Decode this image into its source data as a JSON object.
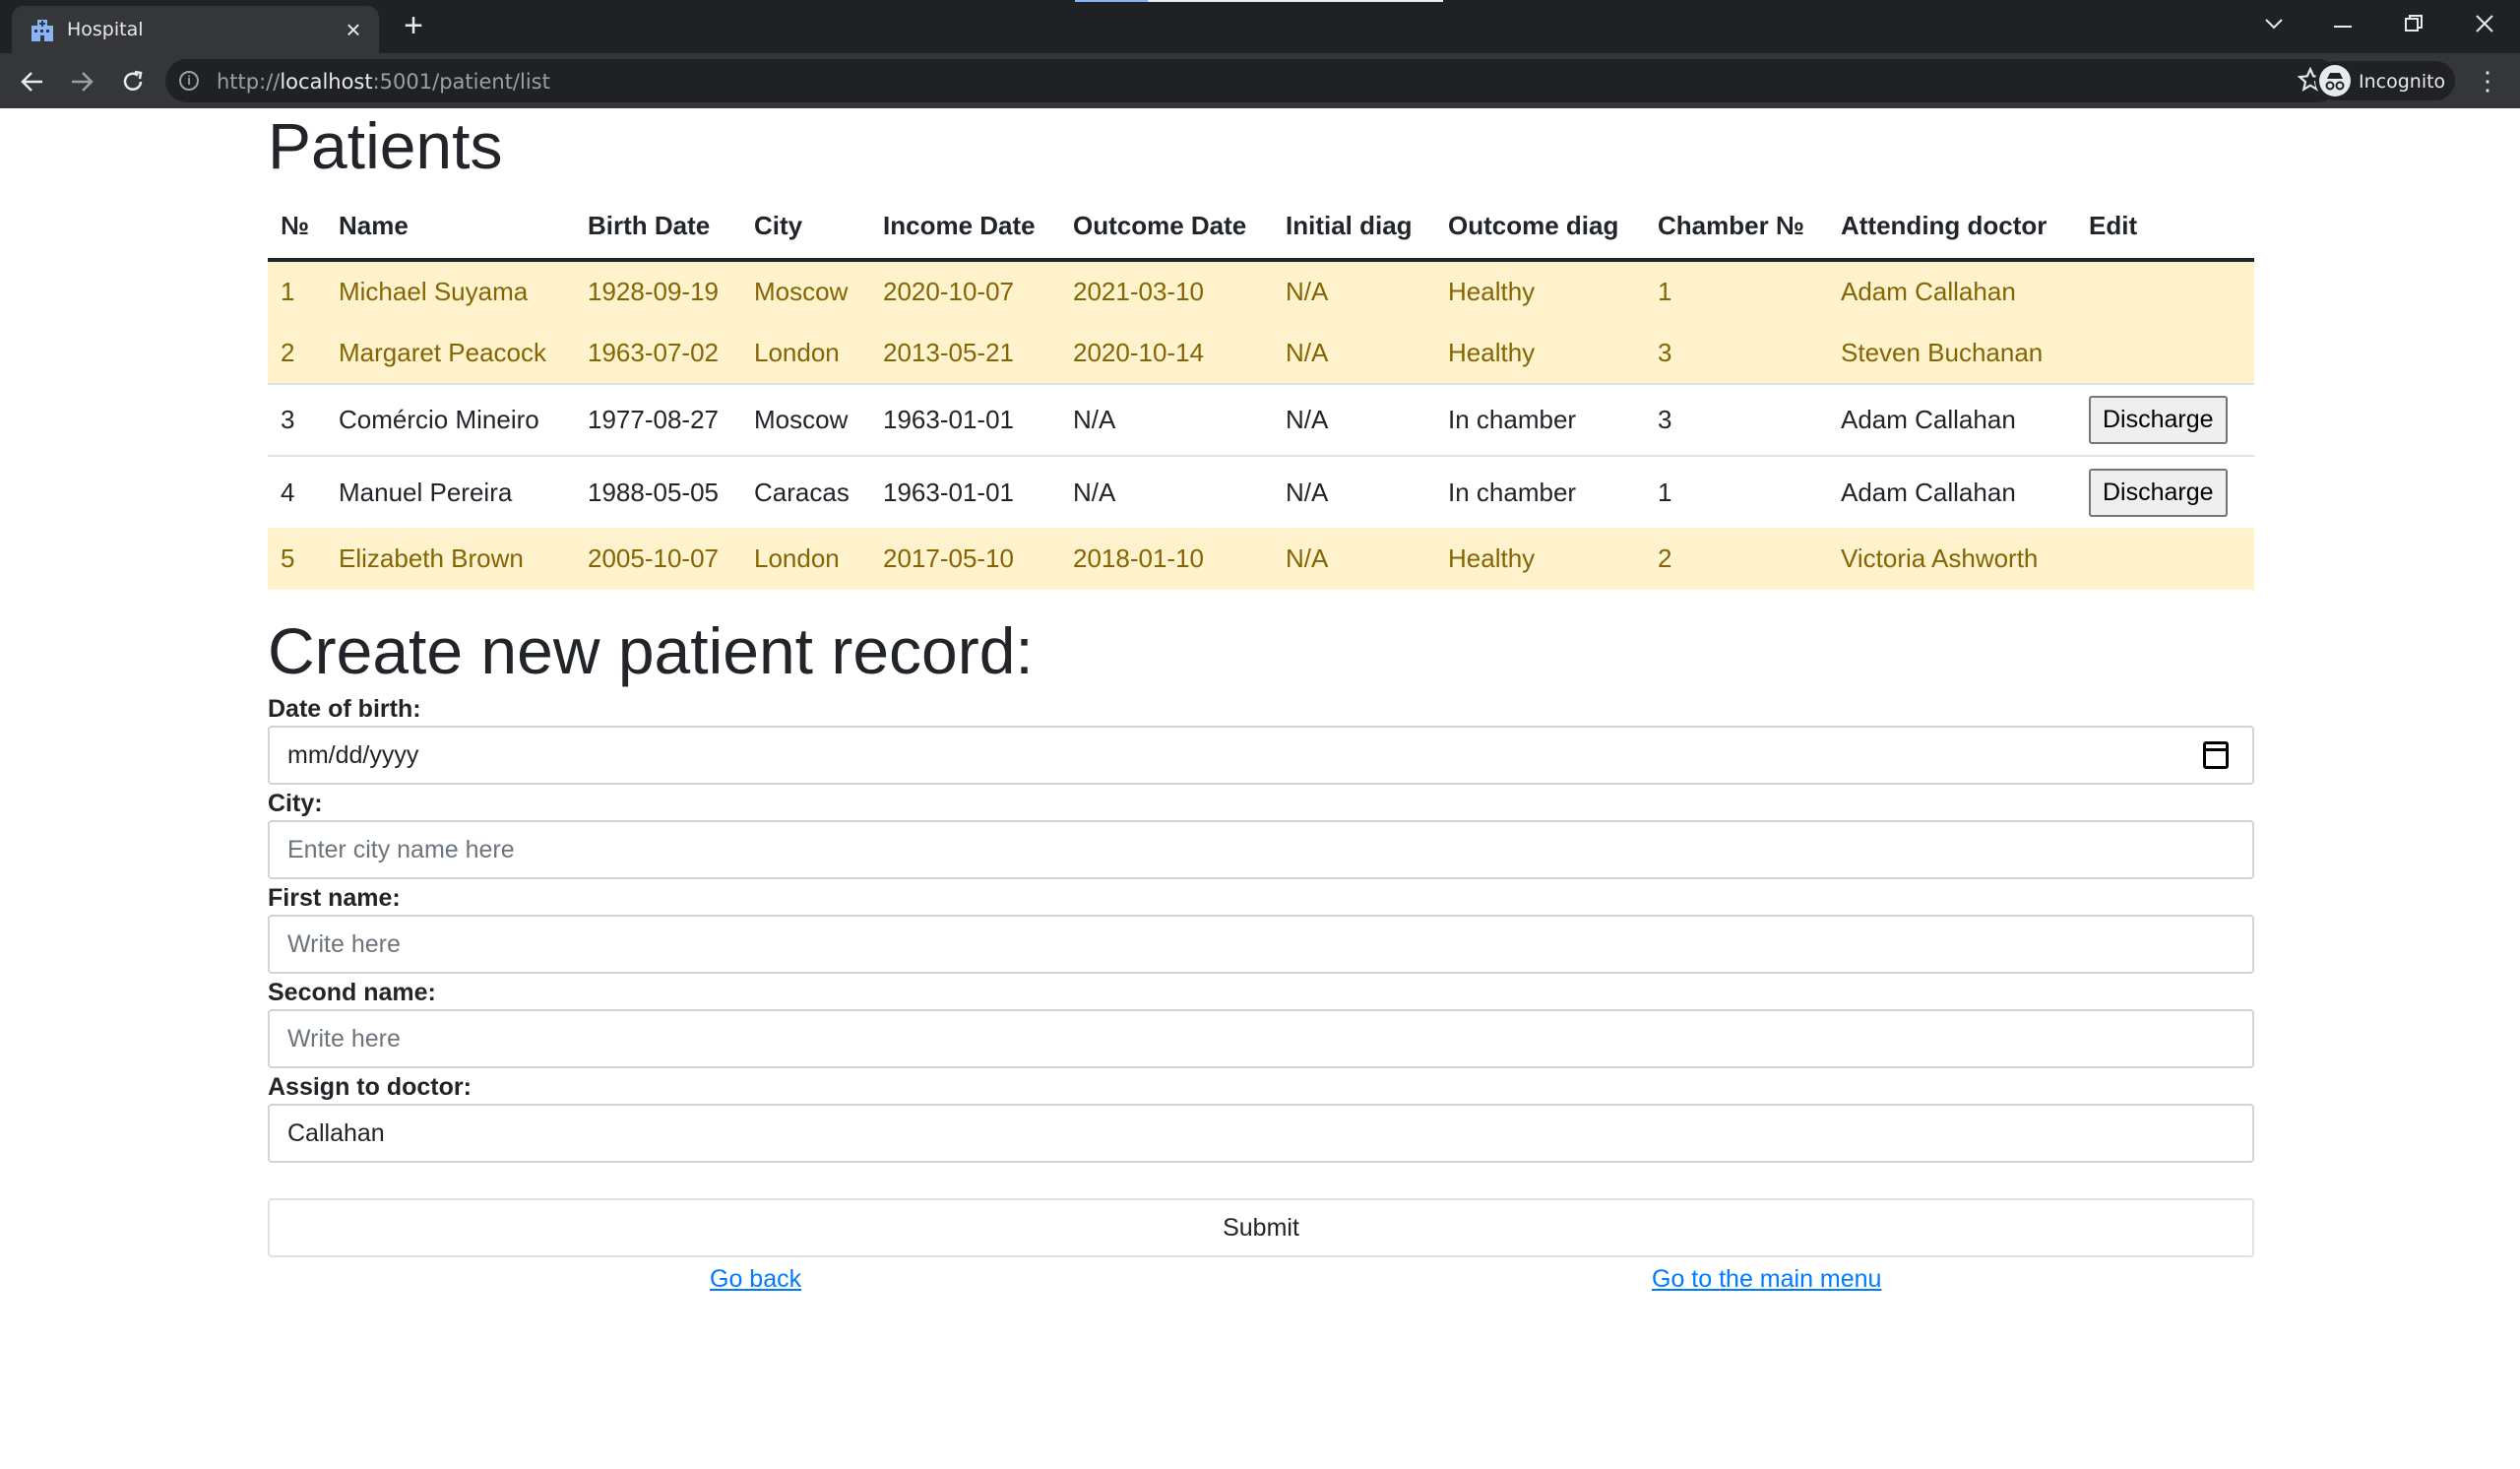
{
  "browser": {
    "tab_title": "Hospital",
    "url_prefix": "http://",
    "url_host": "localhost",
    "url_path": ":5001/patient/list",
    "incognito_label": "Incognito"
  },
  "page": {
    "title": "Patients",
    "columns": [
      "№",
      "Name",
      "Birth Date",
      "City",
      "Income Date",
      "Outcome Date",
      "Initial diag",
      "Outcome diag",
      "Chamber №",
      "Attending doctor",
      "Edit"
    ],
    "rows": [
      {
        "num": "1",
        "name": "Michael Suyama",
        "birth": "1928-09-19",
        "city": "Moscow",
        "income": "2020-10-07",
        "outcome": "2021-03-10",
        "initial": "N/A",
        "outcome_diag": "Healthy",
        "chamber": "1",
        "doctor": "Adam Callahan",
        "edit": ""
      },
      {
        "num": "2",
        "name": "Margaret Peacock",
        "birth": "1963-07-02",
        "city": "London",
        "income": "2013-05-21",
        "outcome": "2020-10-14",
        "initial": "N/A",
        "outcome_diag": "Healthy",
        "chamber": "3",
        "doctor": "Steven Buchanan",
        "edit": ""
      },
      {
        "num": "3",
        "name": "Comércio Mineiro",
        "birth": "1977-08-27",
        "city": "Moscow",
        "income": "1963-01-01",
        "outcome": "N/A",
        "initial": "N/A",
        "outcome_diag": "In chamber",
        "chamber": "3",
        "doctor": "Adam Callahan",
        "edit": "Discharge"
      },
      {
        "num": "4",
        "name": "Manuel Pereira",
        "birth": "1988-05-05",
        "city": "Caracas",
        "income": "1963-01-01",
        "outcome": "N/A",
        "initial": "N/A",
        "outcome_diag": "In chamber",
        "chamber": "1",
        "doctor": "Adam Callahan",
        "edit": "Discharge"
      },
      {
        "num": "5",
        "name": "Elizabeth Brown",
        "birth": "2005-10-07",
        "city": "London",
        "income": "2017-05-10",
        "outcome": "2018-01-10",
        "initial": "N/A",
        "outcome_diag": "Healthy",
        "chamber": "2",
        "doctor": "Victoria Ashworth",
        "edit": ""
      }
    ]
  },
  "form": {
    "title": "Create new patient record:",
    "dob_label": "Date of birth:",
    "dob_value": "mm/dd/yyyy",
    "city_label": "City:",
    "city_placeholder": "Enter city name here",
    "first_label": "First name:",
    "first_placeholder": "Write here",
    "second_label": "Second name:",
    "second_placeholder": "Write here",
    "doctor_label": "Assign to doctor:",
    "doctor_value": "Callahan",
    "submit_label": "Submit",
    "back_link": "Go back",
    "main_menu_link": "Go to the main menu"
  },
  "colors": {
    "warning_row_bg": "#fff3cd",
    "warning_row_text": "#856404",
    "link": "#007bff",
    "chrome_dark": "#202124",
    "chrome_toolbar": "#35363a"
  }
}
